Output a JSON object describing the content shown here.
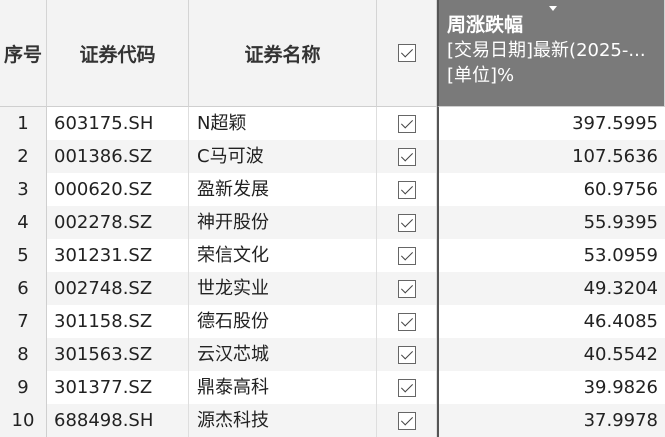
{
  "header": {
    "index": "序号",
    "code": "证券代码",
    "name": "证券名称",
    "selected_column": {
      "title": "周涨跌幅",
      "line2": "[交易日期]最新(2025-...",
      "line3": "[单位]%"
    }
  },
  "rows": [
    {
      "index": "1",
      "code": "603175.SH",
      "name": "N超颖",
      "checked": true,
      "value": "397.5995"
    },
    {
      "index": "2",
      "code": "001386.SZ",
      "name": "C马可波",
      "checked": true,
      "value": "107.5636"
    },
    {
      "index": "3",
      "code": "000620.SZ",
      "name": "盈新发展",
      "checked": true,
      "value": "60.9756"
    },
    {
      "index": "4",
      "code": "002278.SZ",
      "name": "神开股份",
      "checked": true,
      "value": "55.9395"
    },
    {
      "index": "5",
      "code": "301231.SZ",
      "name": "荣信文化",
      "checked": true,
      "value": "53.0959"
    },
    {
      "index": "6",
      "code": "002748.SZ",
      "name": "世龙实业",
      "checked": true,
      "value": "49.3204"
    },
    {
      "index": "7",
      "code": "301158.SZ",
      "name": "德石股份",
      "checked": true,
      "value": "46.4085"
    },
    {
      "index": "8",
      "code": "301563.SZ",
      "name": "云汉芯城",
      "checked": true,
      "value": "40.5542"
    },
    {
      "index": "9",
      "code": "301377.SZ",
      "name": "鼎泰高科",
      "checked": true,
      "value": "39.9826"
    },
    {
      "index": "10",
      "code": "688498.SH",
      "name": "源杰科技",
      "checked": true,
      "value": "37.9978"
    }
  ],
  "colors": {
    "selected_header": "#7a7a7a",
    "header_bg": "#f3f3f3",
    "alt_row": "#f4f4f4"
  }
}
